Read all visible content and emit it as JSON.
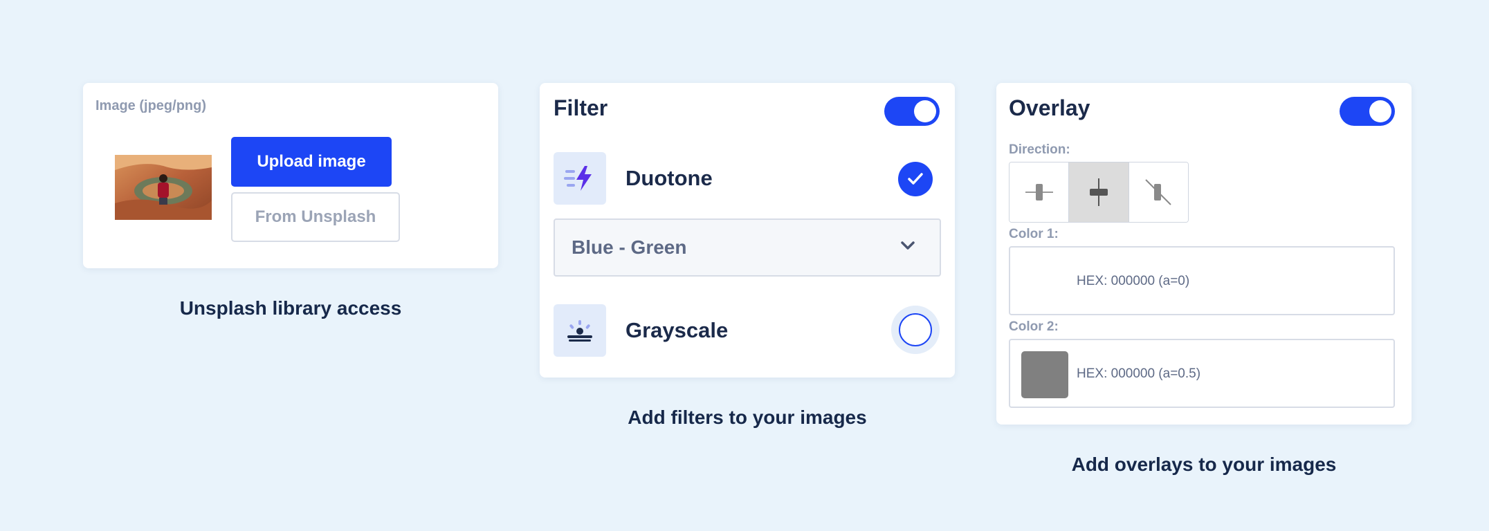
{
  "upload_card": {
    "field_label": "Image (jpeg/png)",
    "upload_button": "Upload image",
    "unsplash_button": "From Unsplash",
    "caption": "Unsplash library access"
  },
  "filter_card": {
    "title": "Filter",
    "toggle_on": true,
    "filters": [
      {
        "name": "Duotone",
        "icon": "lightning-icon",
        "selected": true
      },
      {
        "name": "Grayscale",
        "icon": "sunrise-icon",
        "selected": false
      }
    ],
    "duotone_select": {
      "value": "Blue - Green"
    },
    "caption": "Add filters to your images"
  },
  "overlay_card": {
    "title": "Overlay",
    "toggle_on": true,
    "direction_label": "Direction:",
    "directions": [
      "horizontal",
      "vertical",
      "diagonal"
    ],
    "active_direction": "vertical",
    "color1": {
      "label": "Color 1:",
      "text": "HEX: 000000 (a=0)"
    },
    "color2": {
      "label": "Color 2:",
      "text": "HEX: 000000 (a=0.5)",
      "swatch": "#808080"
    },
    "caption": "Add overlays to your images"
  },
  "colors": {
    "background": "#e9f3fb",
    "accent": "#1d46f5",
    "heading": "#16284a",
    "muted": "#8f9ab0"
  }
}
